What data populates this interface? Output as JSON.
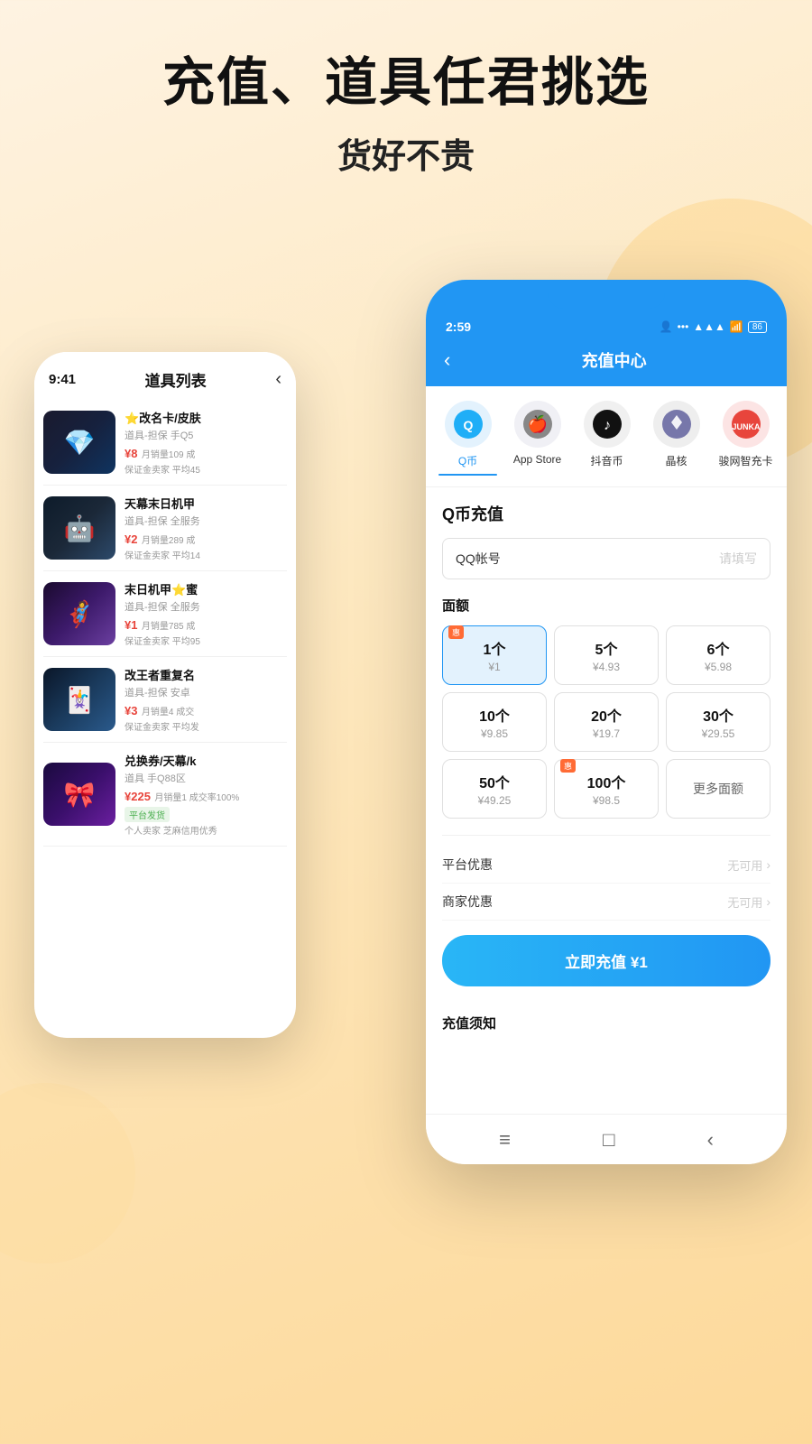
{
  "header": {
    "title_line1": "充值、道具任君挑选",
    "title_line2": "货好不贵"
  },
  "left_phone": {
    "time": "9:41",
    "nav_title": "道具列表",
    "products": [
      {
        "name": "⭐改名卡/皮肤",
        "desc": "道具-担保 手Q5",
        "price": "¥8",
        "sales": "月销量109 成",
        "guarantee": "保证金卖家 平均45",
        "emoji": "💎",
        "bg": "gold"
      },
      {
        "name": "天幕末日机甲",
        "desc": "道具-担保 全服务",
        "price": "¥2",
        "sales": "月销量289 成",
        "guarantee": "保证金卖家 平均14",
        "emoji": "🤖",
        "bg": "mech"
      },
      {
        "name": "末日机甲⭐蜜",
        "desc": "道具-担保 全服务",
        "price": "¥1",
        "sales": "月销量785 成",
        "guarantee": "保证金卖家 平均95",
        "emoji": "🦸",
        "bg": "mech2"
      },
      {
        "name": "改王者重复名",
        "desc": "道具-担保 安卓",
        "price": "¥3",
        "sales": "月销量4 成交",
        "guarantee": "保证金卖家 平均发",
        "emoji": "🃏",
        "bg": "card"
      },
      {
        "name": "兑换券/天幕/k",
        "desc": "道具 手Q88区",
        "price": "¥225",
        "sales": "月销量1 成交率100%",
        "guarantee": "个人卖家 芝麻信用优秀",
        "platform": "平台发货",
        "emoji": "🎀",
        "bg": "exchange"
      }
    ]
  },
  "right_phone": {
    "status_time": "2:59",
    "nav_title": "充值中心",
    "service_tabs": [
      {
        "label": "Q币",
        "active": true,
        "color": "#1FAEF7"
      },
      {
        "label": "App Store",
        "active": false,
        "color": "#888"
      },
      {
        "label": "抖音币",
        "active": false,
        "color": "#111"
      },
      {
        "label": "晶核",
        "active": false,
        "color": "#555"
      },
      {
        "label": "骏网智充卡",
        "active": false,
        "color": "#e8453c"
      }
    ],
    "recharge_title": "Q币充值",
    "account_label": "QQ帐号",
    "account_placeholder": "请填写",
    "amount_title": "面额",
    "amounts": [
      {
        "count": "1个",
        "price": "¥1",
        "selected": true,
        "discount": "惠"
      },
      {
        "count": "5个",
        "price": "¥4.93",
        "selected": false
      },
      {
        "count": "6个",
        "price": "¥5.98",
        "selected": false
      },
      {
        "count": "10个",
        "price": "¥9.85",
        "selected": false
      },
      {
        "count": "20个",
        "price": "¥19.7",
        "selected": false
      },
      {
        "count": "30个",
        "price": "¥29.55",
        "selected": false
      },
      {
        "count": "50个",
        "price": "¥49.25",
        "selected": false
      },
      {
        "count": "100个",
        "price": "¥98.5",
        "selected": false,
        "discount": "惠"
      },
      {
        "count": "更多面额",
        "price": "",
        "selected": false,
        "more": true
      }
    ],
    "promo_rows": [
      {
        "label": "平台优惠",
        "value": "无可用"
      },
      {
        "label": "商家优惠",
        "value": "无可用"
      }
    ],
    "charge_btn": "立即充值 ¥1",
    "notice_title": "充值须知",
    "bottom_nav": [
      "≡",
      "□",
      "＜"
    ]
  }
}
